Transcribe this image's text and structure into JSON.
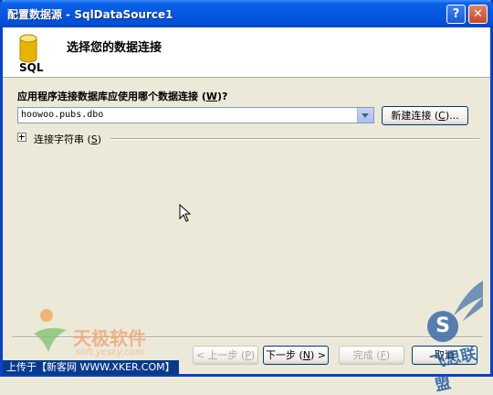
{
  "window": {
    "title": "配置数据源 - SqlDataSource1",
    "help_glyph": "?",
    "close_glyph": "✕"
  },
  "header": {
    "icon_label": "SQL",
    "title": "选择您的数据连接"
  },
  "connection": {
    "question_pre": "应用程序连接数据库应使用哪个数据连接 (",
    "question_key": "W",
    "question_post": ")?",
    "selected_value": "hoowoo.pubs.dbo",
    "new_button_pre": "新建连接 (",
    "new_button_key": "C",
    "new_button_post": ")...",
    "conn_string_pre": "连接字符串 (",
    "conn_string_key": "S",
    "conn_string_post": ")"
  },
  "footer": {
    "prev_pre": "< 上一步 (",
    "prev_key": "P",
    "prev_post": ")",
    "next_pre": "下一步 (",
    "next_key": "N",
    "next_post": ") >",
    "finish_pre": "完成 (",
    "finish_key": "F",
    "finish_post": ")",
    "cancel_label": "取消"
  },
  "watermarks": {
    "site_name": "天极软件",
    "site_url": "soft.yesky.com",
    "union_s": "S",
    "union_text": "飞思联盟",
    "upload_text": "上传于【新客网 WWW.XKER.COM】"
  },
  "colors": {
    "titlebar": "#0557e0",
    "dialog_bg": "#ece9d8",
    "header_bg": "#ffffff",
    "sql_icon": "#e7b400"
  }
}
